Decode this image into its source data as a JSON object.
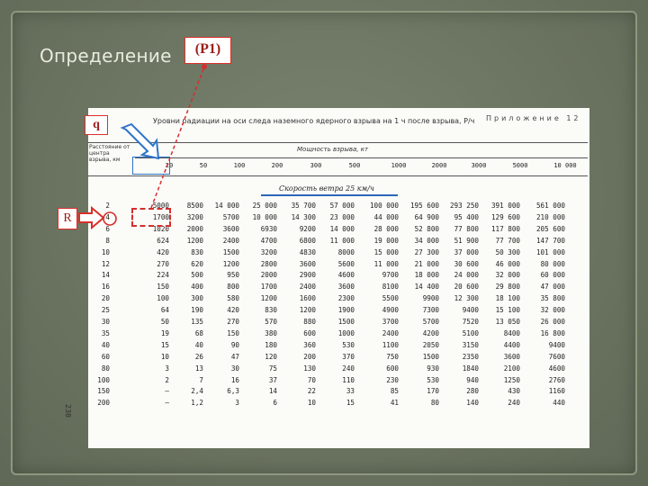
{
  "slide": {
    "title": "Определение",
    "formula": "(P1)",
    "q_label": "q",
    "r_label": "R",
    "accent_red": "#d9302a",
    "accent_blue": "#2e74c9"
  },
  "document": {
    "caption": "Уровни радиации на оси следа наземного ядерного взрыва на 1 ч после взрыва, Р/ч",
    "appendix": "Приложение 12",
    "row_header": "Расстояние от центра взрыва, км",
    "column_header": "Мощность взрыва, кт",
    "wind_label": "Скорость ветра 25 км/ч",
    "page_number": "238",
    "powers": [
      "20",
      "50",
      "100",
      "200",
      "300",
      "500",
      "1000",
      "2000",
      "3000",
      "5000",
      "10 000"
    ],
    "rows": [
      {
        "r": "2",
        "v": [
          "5000",
          "8500",
          "14 000",
          "25 000",
          "35 700",
          "57 000",
          "100 000",
          "195 600",
          "293 250",
          "391 000",
          "561 000"
        ]
      },
      {
        "r": "4",
        "v": [
          "1700",
          "3200",
          "5700",
          "10 000",
          "14 300",
          "23 000",
          "44 000",
          "64 900",
          "95 400",
          "129 600",
          "210 000"
        ]
      },
      {
        "r": "6",
        "v": [
          "1020",
          "2000",
          "3600",
          "6930",
          "9200",
          "14 000",
          "28 000",
          "52 800",
          "77 800",
          "117 800",
          "205 600"
        ]
      },
      {
        "r": "8",
        "v": [
          "624",
          "1200",
          "2400",
          "4700",
          "6800",
          "11 000",
          "19 000",
          "34 000",
          "51 900",
          "77 700",
          "147 700"
        ]
      },
      {
        "r": "10",
        "v": [
          "420",
          "830",
          "1500",
          "3200",
          "4830",
          "8000",
          "15 000",
          "27 300",
          "37 000",
          "50 300",
          "101 000"
        ]
      },
      {
        "r": "12",
        "v": [
          "270",
          "620",
          "1200",
          "2800",
          "3600",
          "5600",
          "11 000",
          "21 000",
          "30 600",
          "46 000",
          "80 000"
        ]
      },
      {
        "r": "14",
        "v": [
          "224",
          "500",
          "950",
          "2000",
          "2900",
          "4600",
          "9700",
          "18 000",
          "24 000",
          "32 000",
          "60 000"
        ]
      },
      {
        "r": "16",
        "v": [
          "150",
          "400",
          "800",
          "1700",
          "2400",
          "3600",
          "8100",
          "14 400",
          "20 600",
          "29 800",
          "47 000"
        ]
      },
      {
        "r": "20",
        "v": [
          "100",
          "300",
          "580",
          "1200",
          "1600",
          "2300",
          "5500",
          "9900",
          "12 300",
          "18 100",
          "35 800"
        ]
      },
      {
        "r": "25",
        "v": [
          "64",
          "190",
          "420",
          "830",
          "1200",
          "1900",
          "4900",
          "7300",
          "9400",
          "15 100",
          "32 000"
        ]
      },
      {
        "r": "30",
        "v": [
          "50",
          "135",
          "270",
          "570",
          "880",
          "1500",
          "3700",
          "5700",
          "7520",
          "13 050",
          "26 000"
        ]
      },
      {
        "r": "35",
        "v": [
          "19",
          "68",
          "150",
          "380",
          "600",
          "1000",
          "2400",
          "4200",
          "5100",
          "8400",
          "16 800"
        ]
      },
      {
        "r": "40",
        "v": [
          "15",
          "40",
          "90",
          "180",
          "360",
          "530",
          "1100",
          "2050",
          "3150",
          "4400",
          "9400"
        ]
      },
      {
        "r": "60",
        "v": [
          "10",
          "26",
          "47",
          "120",
          "200",
          "370",
          "750",
          "1500",
          "2350",
          "3600",
          "7600"
        ]
      },
      {
        "r": "80",
        "v": [
          "3",
          "13",
          "30",
          "75",
          "130",
          "240",
          "600",
          "930",
          "1840",
          "2100",
          "4600"
        ]
      },
      {
        "r": "100",
        "v": [
          "2",
          "7",
          "16",
          "37",
          "70",
          "110",
          "230",
          "530",
          "940",
          "1250",
          "2760"
        ]
      },
      {
        "r": "150",
        "v": [
          "—",
          "2,4",
          "6,3",
          "14",
          "22",
          "33",
          "85",
          "170",
          "280",
          "430",
          "1160"
        ]
      },
      {
        "r": "200",
        "v": [
          "—",
          "1,2",
          "3",
          "6",
          "10",
          "15",
          "41",
          "80",
          "140",
          "240",
          "440"
        ]
      }
    ]
  }
}
